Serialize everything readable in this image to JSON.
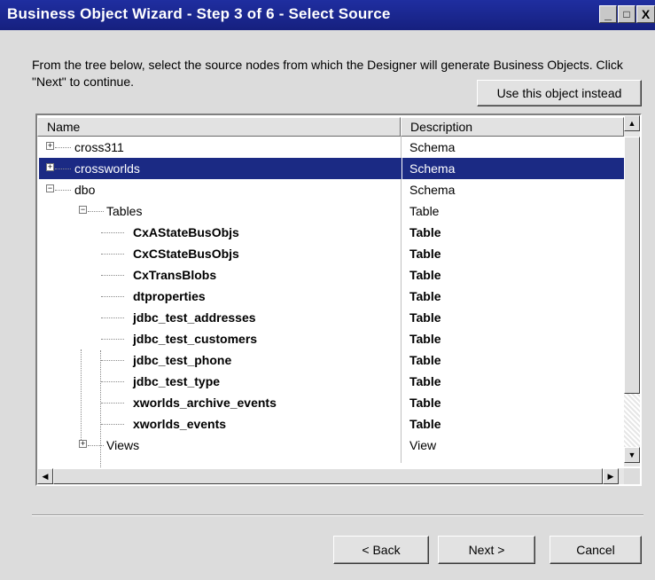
{
  "window": {
    "title": "Business Object Wizard - Step 3 of 6 - Select Source",
    "controls": {
      "minimize": "_",
      "maximize": "□",
      "close": "X"
    }
  },
  "instructions": "From the tree below, select the source nodes from which the Designer will generate Business Objects. Click \"Next\" to continue.",
  "use_object_button": "Use this object instead",
  "grid": {
    "columns": {
      "name": "Name",
      "description": "Description"
    },
    "rows": [
      {
        "name": "cross311",
        "desc": "Schema"
      },
      {
        "name": "crossworlds",
        "desc": "Schema"
      },
      {
        "name": "dbo",
        "desc": "Schema"
      },
      {
        "name": "Tables",
        "desc": "Table"
      },
      {
        "name": "CxAStateBusObjs",
        "desc": "Table"
      },
      {
        "name": "CxCStateBusObjs",
        "desc": "Table"
      },
      {
        "name": "CxTransBlobs",
        "desc": "Table"
      },
      {
        "name": "dtproperties",
        "desc": "Table"
      },
      {
        "name": "jdbc_test_addresses",
        "desc": "Table"
      },
      {
        "name": "jdbc_test_customers",
        "desc": "Table"
      },
      {
        "name": "jdbc_test_phone",
        "desc": "Table"
      },
      {
        "name": "jdbc_test_type",
        "desc": "Table"
      },
      {
        "name": "xworlds_archive_events",
        "desc": "Table"
      },
      {
        "name": "xworlds_events",
        "desc": "Table"
      },
      {
        "name": "Views",
        "desc": "View"
      }
    ]
  },
  "footer": {
    "back": "< Back",
    "next": "Next >",
    "cancel": "Cancel"
  },
  "colors": {
    "titlebar": "#16207f",
    "selection": "#1b2a84"
  }
}
